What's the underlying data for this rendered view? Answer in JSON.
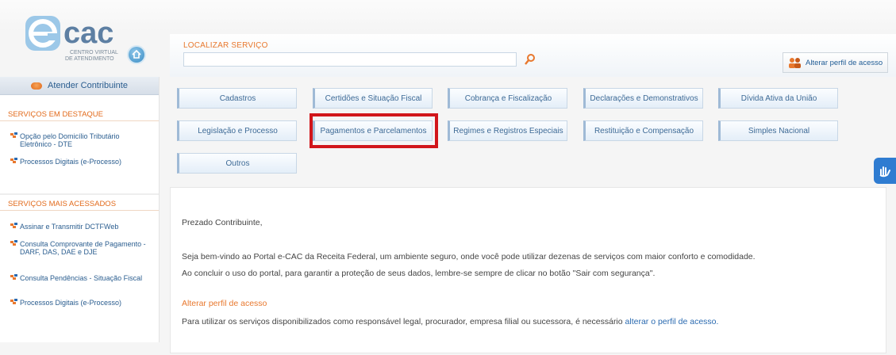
{
  "logo": {
    "brand": "cac",
    "subtitle_line1": "CENTRO VIRTUAL",
    "subtitle_line2": "DE ATENDIMENTO"
  },
  "header": {
    "search_label": "LOCALIZAR SERVIÇO",
    "search_value": "",
    "profile_button": "Alterar perfil de acesso"
  },
  "sidebar": {
    "atender": "Atender Contribuinte",
    "destaque_title": "SERVIÇOS EM DESTAQUE",
    "destaque": [
      {
        "label": "Opção pelo Domicílio Tributário Eletrônico - DTE"
      },
      {
        "label": "Processos Digitais (e-Processo)"
      }
    ],
    "mais_title": "SERVIÇOS MAIS ACESSADOS",
    "mais": [
      {
        "label": "Assinar e Transmitir DCTFWeb"
      },
      {
        "label": "Consulta Comprovante de Pagamento - DARF, DAS, DAE e DJE"
      },
      {
        "label": "Consulta Pendências - Situação Fiscal"
      },
      {
        "label": "Processos Digitais (e-Processo)"
      }
    ]
  },
  "services": [
    "Cadastros",
    "Certidões e Situação Fiscal",
    "Cobrança e Fiscalização",
    "Declarações e Demonstrativos",
    "Dívida Ativa da União",
    "Legislação e Processo",
    "Pagamentos e Parcelamentos",
    "Regimes e Registros Especiais",
    "Restituição e Compensação",
    "Simples Nacional",
    "Outros"
  ],
  "highlighted_service": "Pagamentos e Parcelamentos",
  "content": {
    "greeting": "Prezado Contribuinte,",
    "welcome": "Seja bem-vindo ao Portal e-CAC da Receita Federal, um ambiente seguro, onde você pode utilizar dezenas de serviços com maior conforto e comodidade.",
    "logout_note": "Ao concluir o uso do portal, para garantir a proteção de seus dados, lembre-se sempre de clicar no botão \"Sair com segurança\".",
    "profile_title": "Alterar perfil de acesso",
    "profile_text": "Para utilizar os serviços disponibilizados como responsável legal, procurador, empresa filial ou sucessora, é necessário",
    "profile_link": "alterar o perfil de acesso."
  },
  "colors": {
    "accent": "#e8782e",
    "link": "#2a6ab0",
    "highlight": "#d1161b"
  }
}
